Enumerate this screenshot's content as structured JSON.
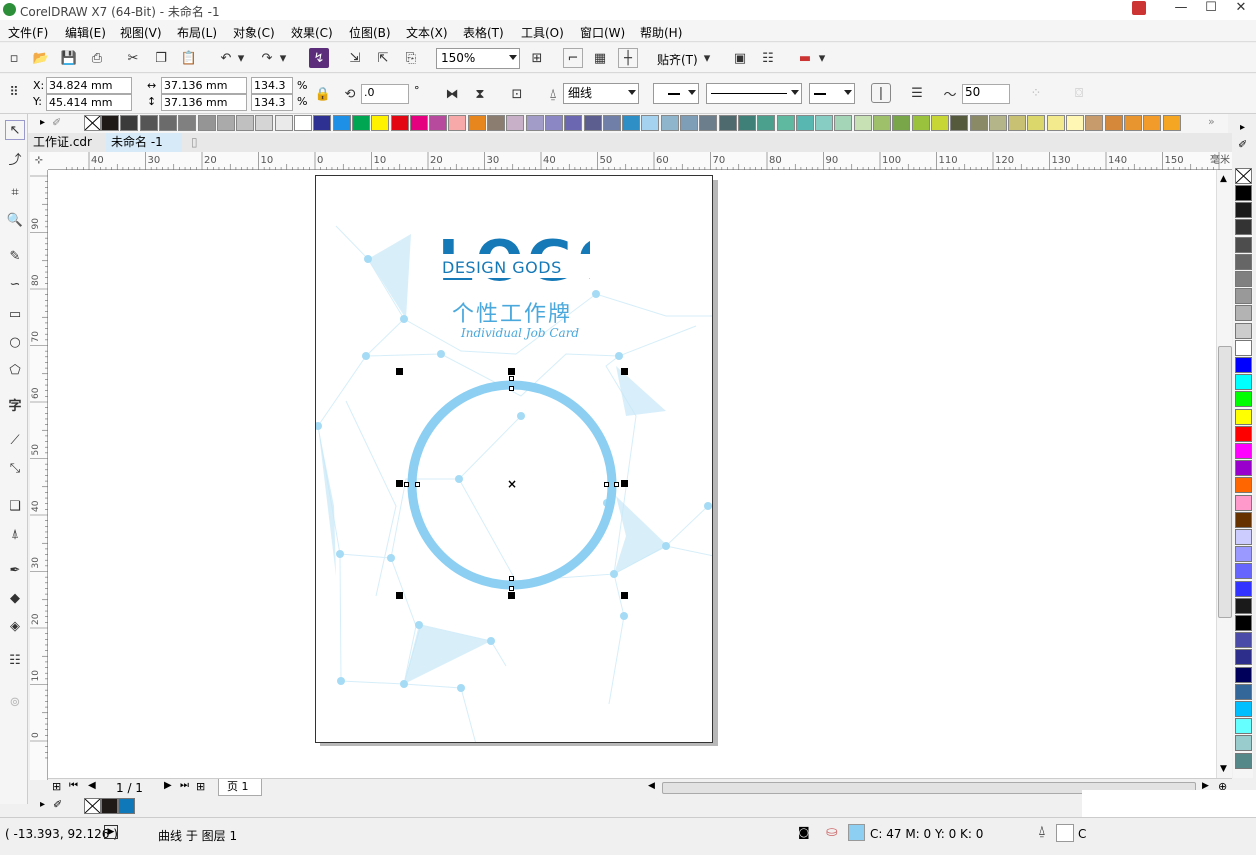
{
  "window": {
    "title": "CorelDRAW X7 (64-Bit) - 未命名 -1",
    "min": "—",
    "max": "☐",
    "close": "✕"
  },
  "menu": [
    "文件(F)",
    "编辑(E)",
    "视图(V)",
    "布局(L)",
    "对象(C)",
    "效果(C)",
    "位图(B)",
    "文本(X)",
    "表格(T)",
    "工具(O)",
    "窗口(W)",
    "帮助(H)"
  ],
  "toolbar": {
    "zoom": "150%",
    "snap": "贴齐(T)"
  },
  "props": {
    "x_label": "X:",
    "x": "34.824 mm",
    "y_label": "Y:",
    "y": "45.414 mm",
    "w": "37.136 mm",
    "h": "37.136 mm",
    "sx": "134.3",
    "sy": "134.3",
    "pct1": "%",
    "pct2": "%",
    "rot": ".0",
    "deg": "°",
    "outline": "细线",
    "smooth": "50"
  },
  "tabs": [
    "工作证.cdr",
    "未命名 -1"
  ],
  "ruler_h": [
    "40",
    "30",
    "20",
    "10",
    "0",
    "10",
    "20",
    "30",
    "40",
    "50",
    "60",
    "70",
    "80",
    "90",
    "100",
    "110",
    "120",
    "130",
    "140",
    "150",
    "毫米"
  ],
  "ruler_v": [
    "90",
    "80",
    "70",
    "60",
    "50",
    "40",
    "30",
    "20",
    "10",
    "0"
  ],
  "design": {
    "logo": "LOGO",
    "brand": "DESIGN GODS",
    "title_cn": "个性工作牌",
    "title_en": "Individual Job Card"
  },
  "pagebar": {
    "page_count": "1 / 1",
    "page_tab": "页 1"
  },
  "status": {
    "coords": "( -13.393, 92.126 )",
    "object": "曲线 于 图层 1",
    "fill": "C: 47 M: 0 Y: 0 K: 0",
    "outline_short": "C"
  },
  "colors": {
    "accent": "#8ccff2",
    "logo": "#1679b7",
    "top_palette": [
      "#1f1a17",
      "#3b3b3b",
      "#555",
      "#6b6b6b",
      "#808080",
      "#959595",
      "#aaa",
      "#c0c0c0",
      "#d5d5d5",
      "#eaeaea",
      "#fff",
      "#2e3192",
      "#1e90e6",
      "#00a651",
      "#fff200",
      "#e30613",
      "#e4007f",
      "#b84a9e",
      "#f7a8a8",
      "#e8861e",
      "#8b7d70",
      "#c9b0c9",
      "#a29cc9",
      "#8a87c4",
      "#6b67b0",
      "#5b5e8f",
      "#6f7fa8",
      "#2e8fc6",
      "#a5d2ef",
      "#8fb5cc",
      "#7d9eb6",
      "#6c7d8c",
      "#4e6a6f",
      "#3f8079",
      "#4aa08c",
      "#5fb8a0",
      "#58b7b0",
      "#87cdc3",
      "#a5d5b7",
      "#c7e1b5",
      "#9fc06a",
      "#7aa64a",
      "#9ac23c",
      "#c7d635",
      "#545a3b",
      "#8a8a66",
      "#b5b58a",
      "#c8c073",
      "#dcd76b",
      "#f2ea8c",
      "#fff7b3",
      "#c79b6b",
      "#d6883a",
      "#e8952f",
      "#f39b2a",
      "#f5a623"
    ],
    "right_palette": [
      "#000",
      "#1a1a1a",
      "#333",
      "#4d4d4d",
      "#666",
      "#808080",
      "#999",
      "#b3b3b3",
      "#ccc",
      "#fff",
      "#0000ff",
      "#00ffff",
      "#00ff00",
      "#ffff00",
      "#ff0000",
      "#ff00ff",
      "#9900cc",
      "#ff6600",
      "#ff99cc",
      "#663300",
      "#ccccff",
      "#9999ff",
      "#6666ff",
      "#3333ff",
      "#1a1a1a",
      "#000",
      "#4a4aa8",
      "#2d2d8c",
      "#00005a",
      "#336699",
      "#00bfff",
      "#66ffff",
      "#99cccc",
      "#558888"
    ]
  }
}
